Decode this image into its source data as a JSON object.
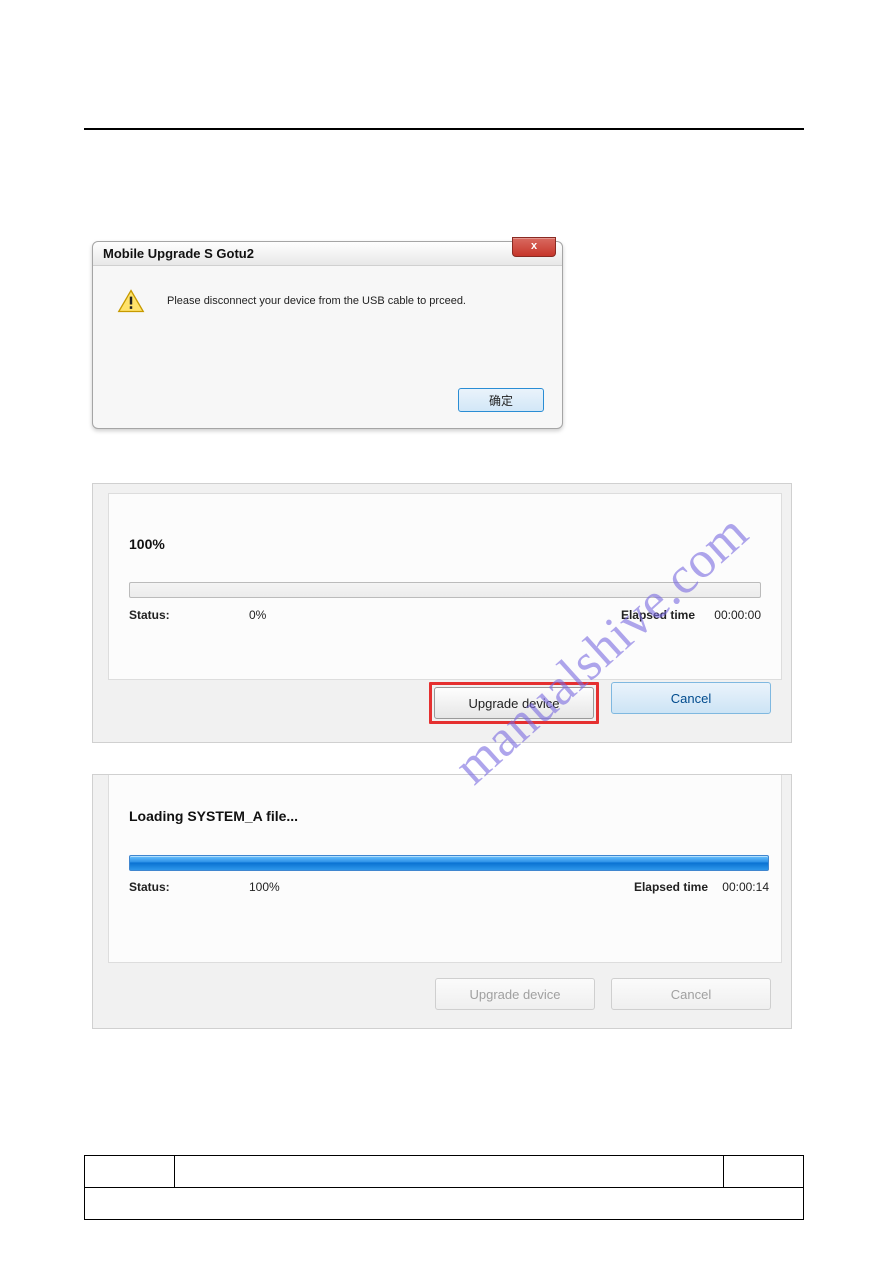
{
  "watermark_text": "manualshive.com",
  "dialog1": {
    "title": "Mobile Upgrade S Gotu2",
    "close_glyph": "x",
    "message": "Please disconnect your device from the USB cable to prceed.",
    "ok_label": "确定"
  },
  "panel2": {
    "percent_label": "100%",
    "status_label": "Status:",
    "status_value": "0%",
    "elapsed_label": "Elapsed time",
    "elapsed_value": "00:00:00",
    "upgrade_label": "Upgrade device",
    "cancel_label": "Cancel"
  },
  "panel3": {
    "loading_label": "Loading SYSTEM_A file...",
    "status_label": "Status:",
    "status_value": "100%",
    "elapsed_label": "Elapsed time",
    "elapsed_value": "00:00:14",
    "upgrade_label": "Upgrade device",
    "cancel_label": "Cancel"
  }
}
